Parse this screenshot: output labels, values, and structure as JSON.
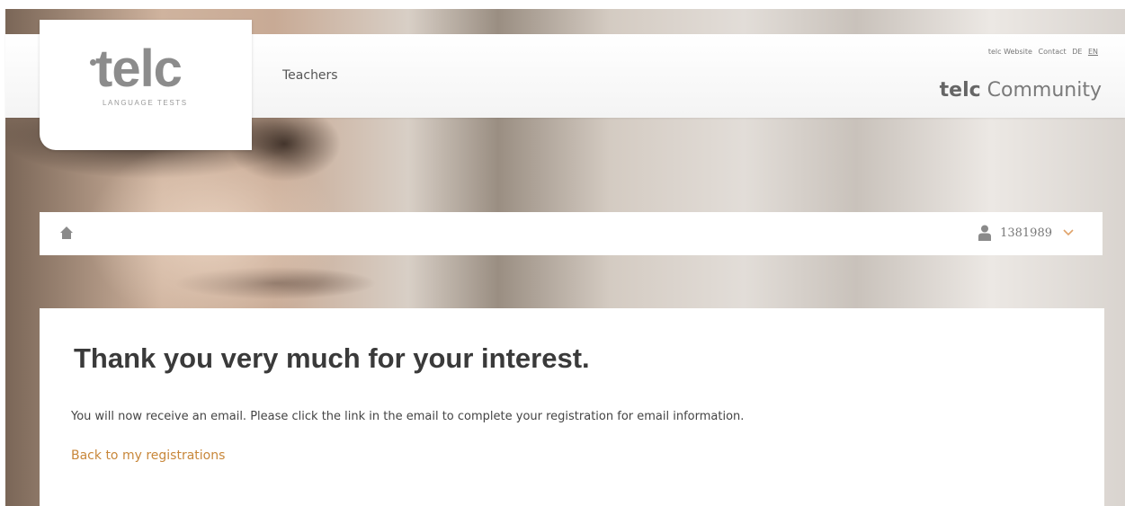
{
  "header": {
    "logo_text": "telc",
    "logo_subtitle": "LANGUAGE TESTS",
    "nav": [
      "Teachers"
    ],
    "top_links": [
      "telc Website",
      "Contact",
      "DE",
      "EN"
    ],
    "community_brand": "telc",
    "community_label": "Community"
  },
  "breadcrumb": {
    "user_id": "1381989"
  },
  "content": {
    "title": "Thank you very much for your interest.",
    "message": "You will now receive an email. Please click the link in the email to complete your registration for email information.",
    "back_link": "Back to my registrations"
  },
  "colors": {
    "accent_link": "#c8873a",
    "logo_gray": "#8c8c8c",
    "title": "#3a3a3a"
  },
  "icons": {
    "home": "home-icon",
    "user": "user-icon",
    "dropdown": "chevron-down-icon"
  }
}
